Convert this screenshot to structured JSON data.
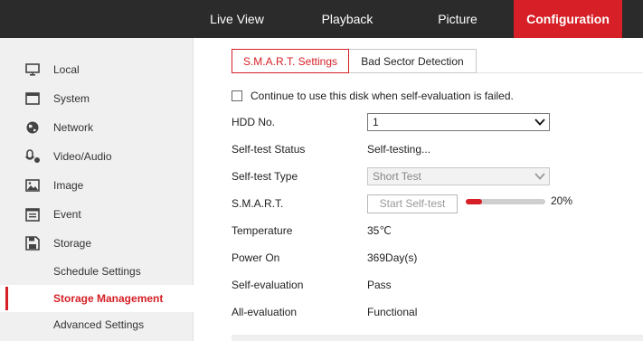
{
  "topnav": {
    "live_view": "Live View",
    "playback": "Playback",
    "picture": "Picture",
    "configuration": "Configuration"
  },
  "sidebar": {
    "items": [
      {
        "label": "Local",
        "icon": "monitor-icon"
      },
      {
        "label": "System",
        "icon": "system-icon"
      },
      {
        "label": "Network",
        "icon": "globe-icon"
      },
      {
        "label": "Video/Audio",
        "icon": "microphone-icon"
      },
      {
        "label": "Image",
        "icon": "image-icon"
      },
      {
        "label": "Event",
        "icon": "event-icon"
      },
      {
        "label": "Storage",
        "icon": "floppy-icon"
      }
    ],
    "subitems": [
      {
        "label": "Schedule Settings"
      },
      {
        "label": "Storage Management"
      },
      {
        "label": "Advanced Settings"
      }
    ]
  },
  "tabs": {
    "smart": "S.M.A.R.T. Settings",
    "bad_sector": "Bad Sector Detection"
  },
  "form": {
    "continue_label": "Continue to use this disk when self-evaluation is failed.",
    "continue_checked": false,
    "hdd_no_label": "HDD No.",
    "hdd_no_value": "1",
    "self_test_status_label": "Self-test Status",
    "self_test_status_value": "Self-testing...",
    "self_test_type_label": "Self-test Type",
    "self_test_type_value": "Short Test",
    "smart_label": "S.M.A.R.T.",
    "start_button": "Start Self-test",
    "progress_percent": 20,
    "progress_text": "20%",
    "temperature_label": "Temperature",
    "temperature_value": "35℃",
    "power_on_label": "Power On",
    "power_on_value": "369Day(s)",
    "self_evaluation_label": "Self-evaluation",
    "self_evaluation_value": "Pass",
    "all_evaluation_label": "All-evaluation",
    "all_evaluation_value": "Functional"
  },
  "colors": {
    "accent": "#d61f26",
    "topbar": "#2b2b2b",
    "sidebar": "#f0f0f0"
  }
}
